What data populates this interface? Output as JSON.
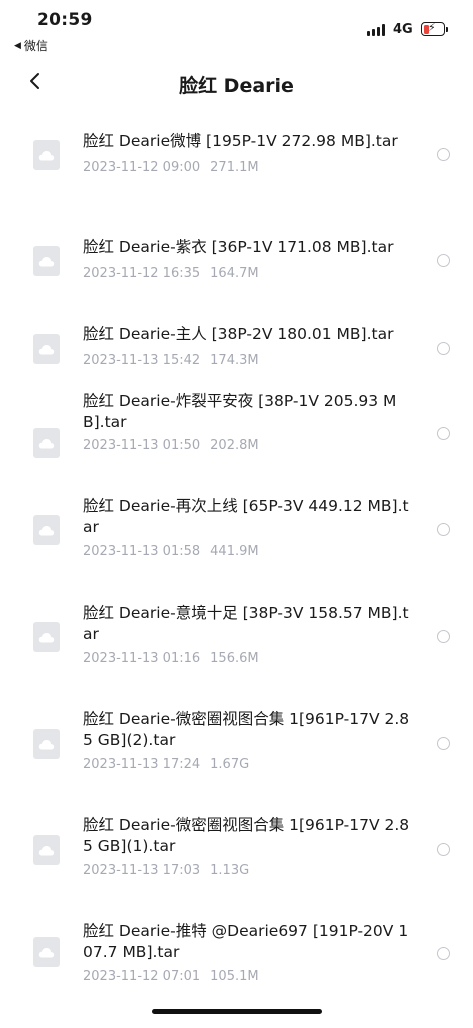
{
  "status_bar": {
    "time": "20:59",
    "back_app": "微信",
    "network": "4G"
  },
  "nav": {
    "title": "脸红 Dearie"
  },
  "files": [
    {
      "name": "脸红 Dearie微博 [195P-1V 272.98 MB].tar",
      "date": "2023-11-12 09:00",
      "size": "271.1M"
    },
    {
      "name": "脸红 Dearie-紫衣 [36P-1V 171.08 MB].tar",
      "date": "2023-11-12 16:35",
      "size": "164.7M"
    },
    {
      "name": "脸红 Dearie-主人 [38P-2V 180.01 MB].tar",
      "date": "2023-11-13 15:42",
      "size": "174.3M"
    },
    {
      "name": "脸红 Dearie-炸裂平安夜 [38P-1V 205.93 MB].tar",
      "date": "2023-11-13 01:50",
      "size": "202.8M"
    },
    {
      "name": "脸红 Dearie-再次上线 [65P-3V 449.12 MB].tar",
      "date": "2023-11-13 01:58",
      "size": "441.9M"
    },
    {
      "name": "脸红 Dearie-意境十足 [38P-3V 158.57 MB].tar",
      "date": "2023-11-13 01:16",
      "size": "156.6M"
    },
    {
      "name": "脸红 Dearie-微密圈视图合集 1[961P-17V 2.85 GB](2).tar",
      "date": "2023-11-13 17:24",
      "size": "1.67G"
    },
    {
      "name": "脸红 Dearie-微密圈视图合集 1[961P-17V 2.85 GB](1).tar",
      "date": "2023-11-13 17:03",
      "size": "1.13G"
    },
    {
      "name": "脸红 Dearie-推特 @Dearie697 [191P-20V 107.7 MB].tar",
      "date": "2023-11-12 07:01",
      "size": "105.1M"
    }
  ]
}
